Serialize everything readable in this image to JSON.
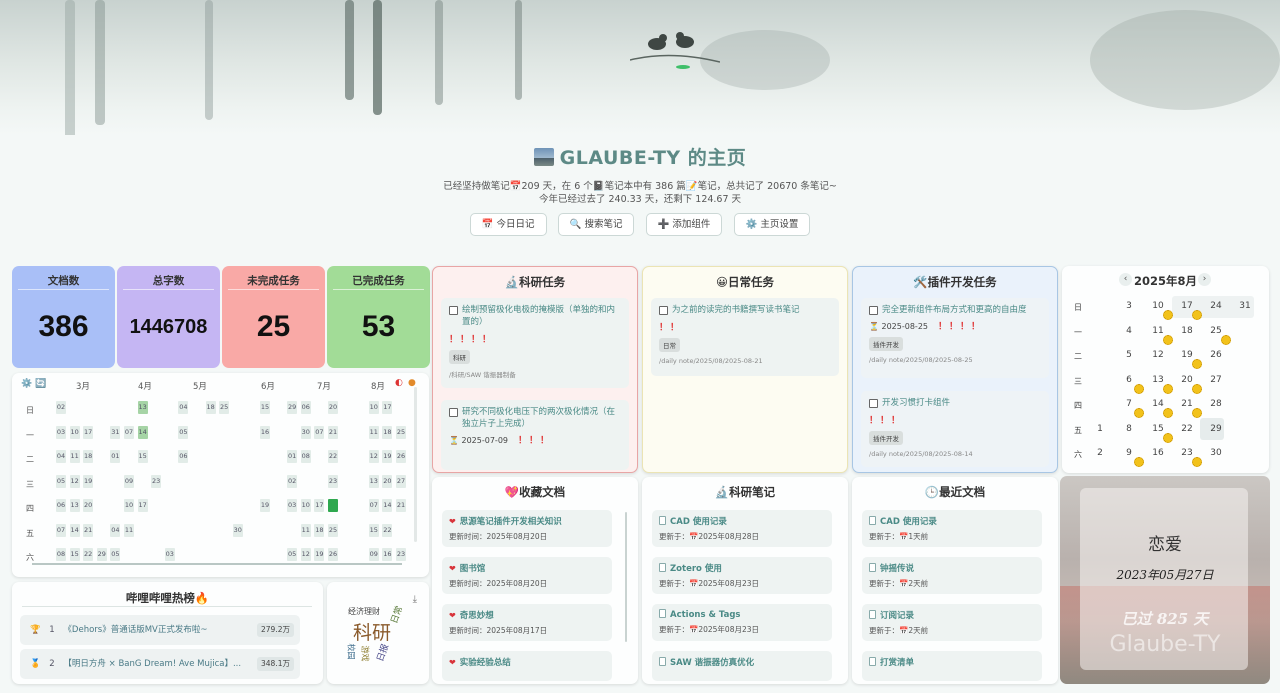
{
  "header": {
    "title": "GLAUBE-TY 的主页",
    "stats_line1": "已经坚持做笔记📅209 天，在 6 个📓笔记本中有 386 篇📝笔记，总共记了 20670 条笔记~",
    "stats_line2": "今年已经过去了 240.33 天，还剩下 124.67 天",
    "buttons": [
      "📅 今日日记",
      "🔍 搜索笔记",
      "➕ 添加组件",
      "⚙️ 主页设置"
    ]
  },
  "metrics": [
    {
      "label": "文档数",
      "value": "386",
      "color": "#a9bff7"
    },
    {
      "label": "总字数",
      "value": "1446708",
      "color": "#c5b6f3"
    },
    {
      "label": "未完成任务",
      "value": "25",
      "color": "#f9a9a6"
    },
    {
      "label": "已完成任务",
      "value": "53",
      "color": "#a2dc97"
    }
  ],
  "heatmap": {
    "toolbar": "⚙️ 🔄",
    "months": [
      "3月",
      "4月",
      "5月",
      "6月",
      "7月",
      "8月"
    ],
    "days": [
      "日",
      "一",
      "二",
      "三",
      "四",
      "五",
      "六"
    ],
    "rows": [
      [
        "02",
        "",
        "",
        "",
        "",
        "",
        "13",
        "",
        "",
        "04",
        "",
        "18",
        "25",
        "",
        "",
        "15",
        "",
        "29",
        "06",
        "",
        "20",
        "",
        "",
        "10",
        "17",
        ""
      ],
      [
        "03",
        "10",
        "17",
        "",
        "31",
        "07",
        "14",
        "",
        "",
        "05",
        "",
        "",
        "",
        "",
        "",
        "16",
        "",
        "",
        "30",
        "07",
        "21",
        "",
        "",
        "11",
        "18",
        "25"
      ],
      [
        "04",
        "11",
        "18",
        "",
        "01",
        "",
        "15",
        "",
        "",
        "06",
        "",
        "",
        "",
        "",
        "",
        "",
        "",
        "01",
        "08",
        "",
        "22",
        "",
        "",
        "12",
        "19",
        "26"
      ],
      [
        "05",
        "12",
        "19",
        "",
        "",
        "09",
        "",
        "23",
        "",
        "",
        "",
        "",
        "",
        "",
        "",
        "",
        "",
        "02",
        "",
        "",
        "23",
        "",
        "",
        "13",
        "20",
        "27"
      ],
      [
        "06",
        "13",
        "20",
        "",
        "",
        "10",
        "17",
        "",
        "",
        "",
        "",
        "",
        "",
        "",
        "",
        "19",
        "",
        "03",
        "10",
        "17",
        "24",
        "",
        "",
        "07",
        "14",
        "21"
      ],
      [
        "07",
        "14",
        "21",
        "",
        "04",
        "11",
        "",
        "",
        "",
        "",
        "",
        "",
        "",
        "30",
        "",
        "",
        "",
        "",
        "11",
        "18",
        "25",
        "",
        "",
        "15",
        "22",
        ""
      ],
      [
        "08",
        "15",
        "22",
        "29",
        "05",
        "",
        "",
        "",
        "03",
        "",
        "",
        "",
        "",
        "",
        "",
        "",
        "",
        "05",
        "12",
        "19",
        "26",
        "",
        "",
        "09",
        "16",
        "23"
      ]
    ]
  },
  "tasks": [
    {
      "title": "🔬科研任务",
      "items": [
        {
          "text": "绘制预留极化电极的掩模版（单独的和内置的）",
          "bang": "！！！！",
          "tag": "科研",
          "path": "/科研/SAW 谐振器制备"
        },
        {
          "text": "研究不同极化电压下的两次极化情况（在独立片子上完成）",
          "date": "⏳ 2025-07-09",
          "bang": "！！！"
        }
      ]
    },
    {
      "title": "😀日常任务",
      "items": [
        {
          "text": "为之前的读完的书籍撰写读书笔记",
          "bang": "！！",
          "tag": "日常",
          "path": "/daily note/2025/08/2025-08-21"
        }
      ]
    },
    {
      "title": "🛠️插件开发任务",
      "items": [
        {
          "text": "完全更新组件布局方式和更高的自由度",
          "date": "⏳ 2025-08-25",
          "bang": "！！！！",
          "tag": "插件开发",
          "path": "/daily note/2025/08/2025-08-25"
        },
        {
          "text": "开发习惯打卡组件",
          "bang": "！！！",
          "tag": "插件开发",
          "path": "/daily note/2025/08/2025-08-14"
        }
      ]
    }
  ],
  "calendar": {
    "title": "2025年8月",
    "weekdays": [
      "日",
      "一",
      "二",
      "三",
      "四",
      "五",
      "六"
    ],
    "cols": [
      [
        "",
        "",
        "",
        "",
        "",
        "1",
        "2"
      ],
      [
        "3",
        "4",
        "5",
        "6",
        "7",
        "8",
        "9"
      ],
      [
        "10",
        "11",
        "12",
        "13",
        "14",
        "15",
        "16"
      ],
      [
        "17",
        "18",
        "19",
        "20",
        "21",
        "22",
        "23"
      ],
      [
        "24",
        "25",
        "26",
        "27",
        "28",
        "29",
        "30"
      ],
      [
        "31",
        "",
        "",
        "",
        "",
        "",
        ""
      ]
    ]
  },
  "favorites": {
    "title": "💖收藏文档",
    "items": [
      {
        "name": "思源笔记插件开发相关知识",
        "meta": "更新时间：2025年08月20日"
      },
      {
        "name": "图书馆",
        "meta": "更新时间：2025年08月20日"
      },
      {
        "name": "奇思妙想",
        "meta": "更新时间：2025年08月17日"
      },
      {
        "name": "实验经验总结",
        "meta": ""
      }
    ]
  },
  "research_notes": {
    "title": "🔬科研笔记",
    "items": [
      {
        "name": "CAD 使用记录",
        "meta": "更新于：📅2025年08月28日"
      },
      {
        "name": "Zotero 使用",
        "meta": "更新于：📅2025年08月23日"
      },
      {
        "name": "Actions & Tags",
        "meta": "更新于：📅2025年08月23日"
      },
      {
        "name": "SAW 谐振器仿真优化",
        "meta": ""
      }
    ]
  },
  "recent_docs": {
    "title": "🕒最近文档",
    "items": [
      {
        "name": "CAD 使用记录",
        "meta": "更新于：📅1天前"
      },
      {
        "name": "钟摇传说",
        "meta": "更新于：📅2天前"
      },
      {
        "name": "订阅记录",
        "meta": "更新于：📅2天前"
      },
      {
        "name": "打赏清单",
        "meta": ""
      }
    ]
  },
  "bilibili": {
    "title": "哔哩哔哩热榜🔥",
    "items": [
      {
        "rank": "1",
        "title": "《Dehors》普通话版MV正式发布啦~",
        "hot": "279.2万"
      },
      {
        "rank": "2",
        "title": "【明日方舟 × BanG Dream! Ave Mujica】...",
        "hot": "348.1万"
      }
    ]
  },
  "wordcloud": {
    "words": [
      "科研",
      "经济理财",
      "日常",
      "校园",
      "游戏",
      "日报"
    ]
  },
  "love": {
    "title": "恋爱",
    "date": "2023年05月27日",
    "days": "已过 825 天",
    "name": "Glaube-TY"
  }
}
